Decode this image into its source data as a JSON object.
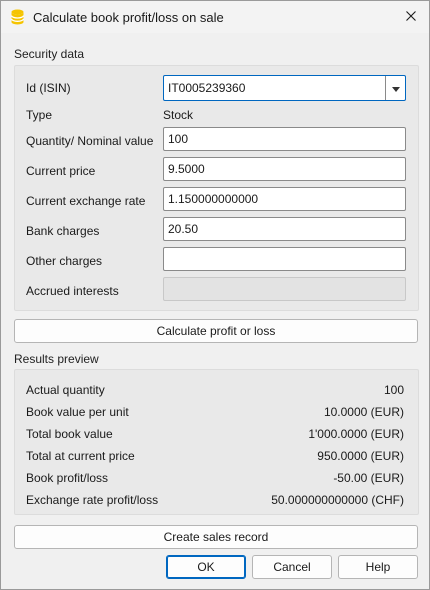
{
  "window": {
    "title": "Calculate book profit/loss on sale",
    "app_icon": "database-icon",
    "close_icon": "close-icon"
  },
  "security": {
    "section_label": "Security data",
    "fields": {
      "id": {
        "label": "Id (ISIN)",
        "value": "IT0005239360"
      },
      "type": {
        "label": "Type",
        "value": "Stock"
      },
      "quantity": {
        "label": "Quantity/ Nominal value",
        "value": "100"
      },
      "current_price": {
        "label": "Current price",
        "value": "9.5000"
      },
      "exchange_rate": {
        "label": "Current exchange rate",
        "value": "1.150000000000"
      },
      "bank_charges": {
        "label": "Bank charges",
        "value": "20.50"
      },
      "other_charges": {
        "label": "Other charges",
        "value": ""
      },
      "accrued_interests": {
        "label": "Accrued interests",
        "value": ""
      }
    }
  },
  "calculate_button": "Calculate profit or loss",
  "results": {
    "section_label": "Results preview",
    "rows": [
      {
        "label": "Actual quantity",
        "value": "100"
      },
      {
        "label": "Book value per unit",
        "value": "10.0000 (EUR)"
      },
      {
        "label": "Total book value",
        "value": "1'000.0000 (EUR)"
      },
      {
        "label": "Total at current price",
        "value": "950.0000 (EUR)"
      },
      {
        "label": "Book profit/loss",
        "value": "-50.00 (EUR)"
      },
      {
        "label": "Exchange rate profit/loss",
        "value": "50.000000000000 (CHF)"
      }
    ]
  },
  "create_sales_record_button": "Create sales record",
  "footer": {
    "ok": "OK",
    "cancel": "Cancel",
    "help": "Help"
  },
  "colors": {
    "accent": "#0067c0",
    "icon_yellow": "#f5c400"
  }
}
